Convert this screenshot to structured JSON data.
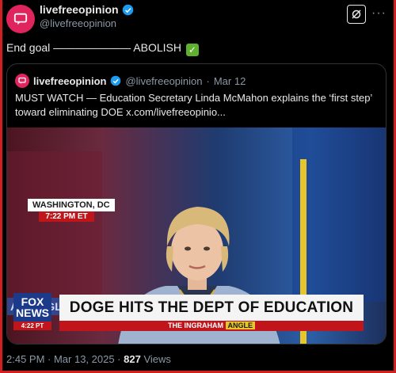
{
  "header": {
    "display_name": "livefreeopinion",
    "handle": "@livefreeopinion"
  },
  "post": {
    "text": "End goal ——————— ABOLISH",
    "emoji": "✅"
  },
  "quote": {
    "display_name": "livefreeopinion",
    "handle": "@livefreeopinion",
    "separator": "·",
    "date": "Mar 12",
    "text": "MUST WATCH — Education Secretary Linda McMahon explains the ‘first step’ toward eliminating DOE  x.com/livefreeopinio..."
  },
  "video": {
    "location": "WASHINGTON, DC",
    "location_time": "7:22 PM ET",
    "side_label": "AM ANGLE",
    "network_logo": "FOX NEWS",
    "network_time": "4:22 PT",
    "headline": "DOGE HITS THE DEPT OF EDUCATION",
    "show_prefix": "THE INGRAHAM",
    "show_suffix": "ANGLE"
  },
  "footer": {
    "timestamp": "2:45 PM · Mar 13, 2025 ·",
    "views_count": "827",
    "views_label": "Views"
  },
  "colors": {
    "background": "#000000",
    "frame_border": "#d21f1f",
    "verified": "#1d9bf0",
    "avatar": "#e0245e",
    "fox_red": "#c0161b",
    "fox_blue": "#1b3a8a"
  },
  "icons": [
    "chat-bubble-icon",
    "verified-badge-icon",
    "grok-icon",
    "more-icon",
    "checkmark-emoji"
  ]
}
